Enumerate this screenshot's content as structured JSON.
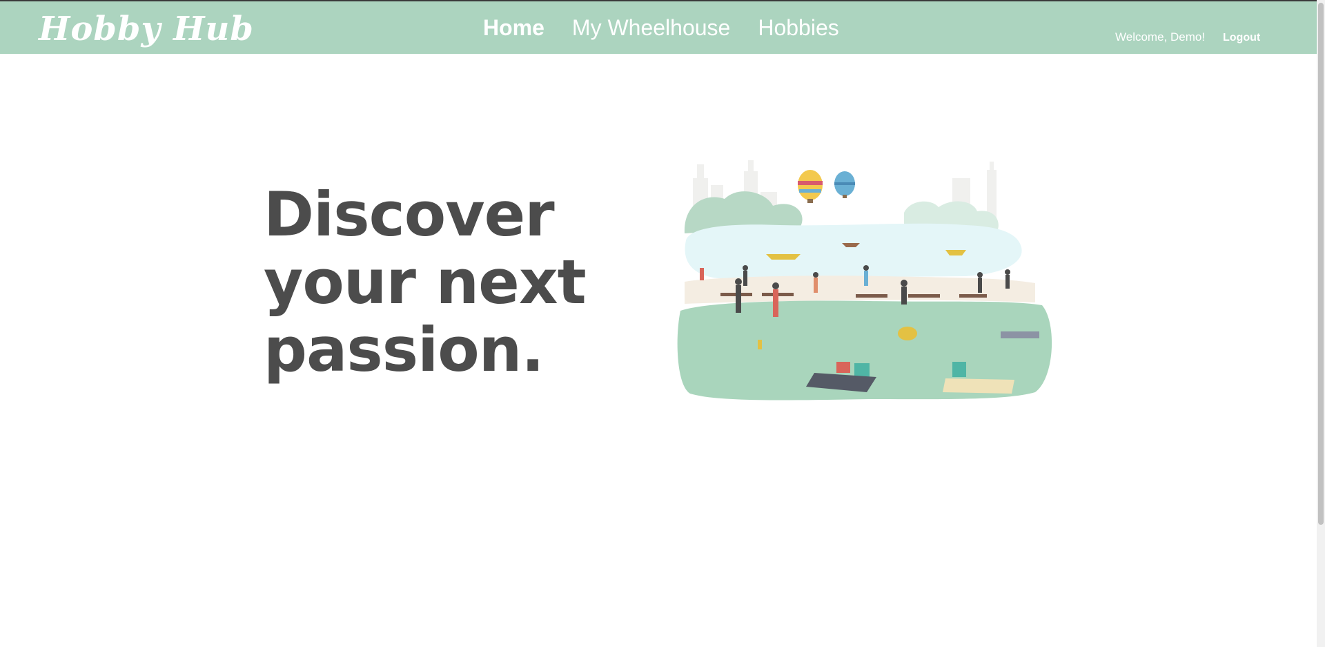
{
  "nav": {
    "logo": "Hobby Hub",
    "links": [
      {
        "label": "Home",
        "active": true
      },
      {
        "label": "My Wheelhouse",
        "active": false
      },
      {
        "label": "Hobbies",
        "active": false
      }
    ],
    "welcome": "Welcome, Demo!",
    "logout": "Logout"
  },
  "hero": {
    "lines": [
      "Discover",
      "your next",
      "passion."
    ]
  },
  "colors": {
    "navbar": "#acd4bf",
    "heading": "#4c4c4c",
    "nav_text": "#ffffff"
  },
  "illustration": {
    "name": "park-scene-illustration"
  }
}
